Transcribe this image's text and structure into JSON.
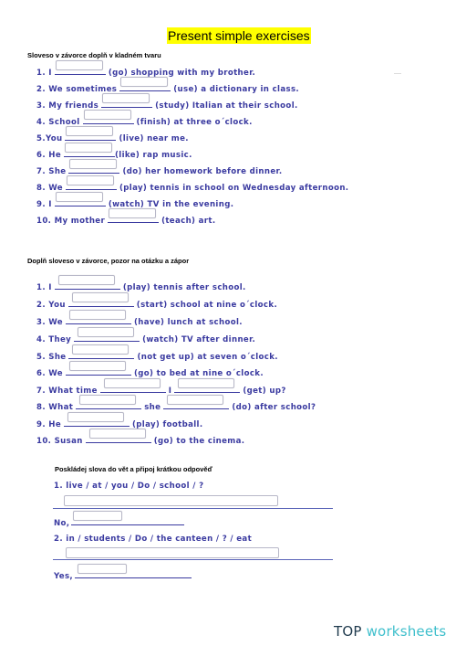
{
  "title": "Present simple exercises",
  "section1": {
    "heading": "Sloveso v závorce doplň v kladném tvaru",
    "items": [
      {
        "pre": "1. I",
        "post": "(go) shopping with my brother.",
        "value": ""
      },
      {
        "pre": "2. We sometimes",
        "post": "(use) a dictionary in class.",
        "value": ""
      },
      {
        "pre": "3. My friends",
        "post": "(study) Italian at their school.",
        "value": ""
      },
      {
        "pre": "4. School",
        "post": "(finish) at three o´clock.",
        "value": ""
      },
      {
        "pre": "5.You",
        "post": "(live) near me.",
        "value": ""
      },
      {
        "pre": "6. He",
        "post": "(like) rap music.",
        "value": ""
      },
      {
        "pre": "7. She",
        "post": "(do) her homework before dinner.",
        "value": ""
      },
      {
        "pre": "8. We",
        "post": "(play) tennis in school on Wednesday afternoon.",
        "value": ""
      },
      {
        "pre": "9. I",
        "post": "(watch) TV in the evening.",
        "value": ""
      },
      {
        "pre": "10. My mother",
        "post": "(teach) art.",
        "value": ""
      }
    ]
  },
  "section2": {
    "heading": "Doplň sloveso v závorce, pozor na otázku a zápor",
    "items": [
      {
        "pre": "1. I",
        "post": "(play) tennis after school.",
        "value": ""
      },
      {
        "pre": "2. You",
        "post": "(start) school at nine o´clock.",
        "value": ""
      },
      {
        "pre": "3. We",
        "post": "(have) lunch at school.",
        "value": ""
      },
      {
        "pre": "4. They",
        "post": "(watch) TV after dinner.",
        "value": ""
      },
      {
        "pre": "5. She",
        "post": "(not get up) at seven o´clock.",
        "value": ""
      },
      {
        "pre": "6. We",
        "post": "(go) to bed at nine o´clock.",
        "value": ""
      },
      {
        "pre": "7. What time",
        "mid": "I",
        "post": "(get) up?",
        "value": "",
        "value2": ""
      },
      {
        "pre": "8. What",
        "mid": "she",
        "post": "(do) after school?",
        "value": "",
        "value2": ""
      },
      {
        "pre": "9. He",
        "post": "(play) football.",
        "value": ""
      },
      {
        "pre": "10. Susan",
        "post": "(go) to the cinema.",
        "value": ""
      }
    ]
  },
  "section3": {
    "heading": "Poskládej slova do vět a připoj krátkou odpověď",
    "items": [
      {
        "prompt": "1. live / at / you / Do / school / ?",
        "sentence_value": "",
        "short_label": "No,",
        "short_value": ""
      },
      {
        "prompt": "2. in / students / Do / the canteen / ? / eat",
        "sentence_value": "",
        "short_label": "Yes,",
        "short_value": ""
      }
    ]
  },
  "branding": {
    "logo_top": "TOP",
    "logo_rest": "worksheets",
    "colors": {
      "top": "#1f3a4d",
      "worksheets": "#3fbfcc",
      "title_highlight": "#ffff00",
      "exercise_text": "#3a3aa0"
    }
  }
}
